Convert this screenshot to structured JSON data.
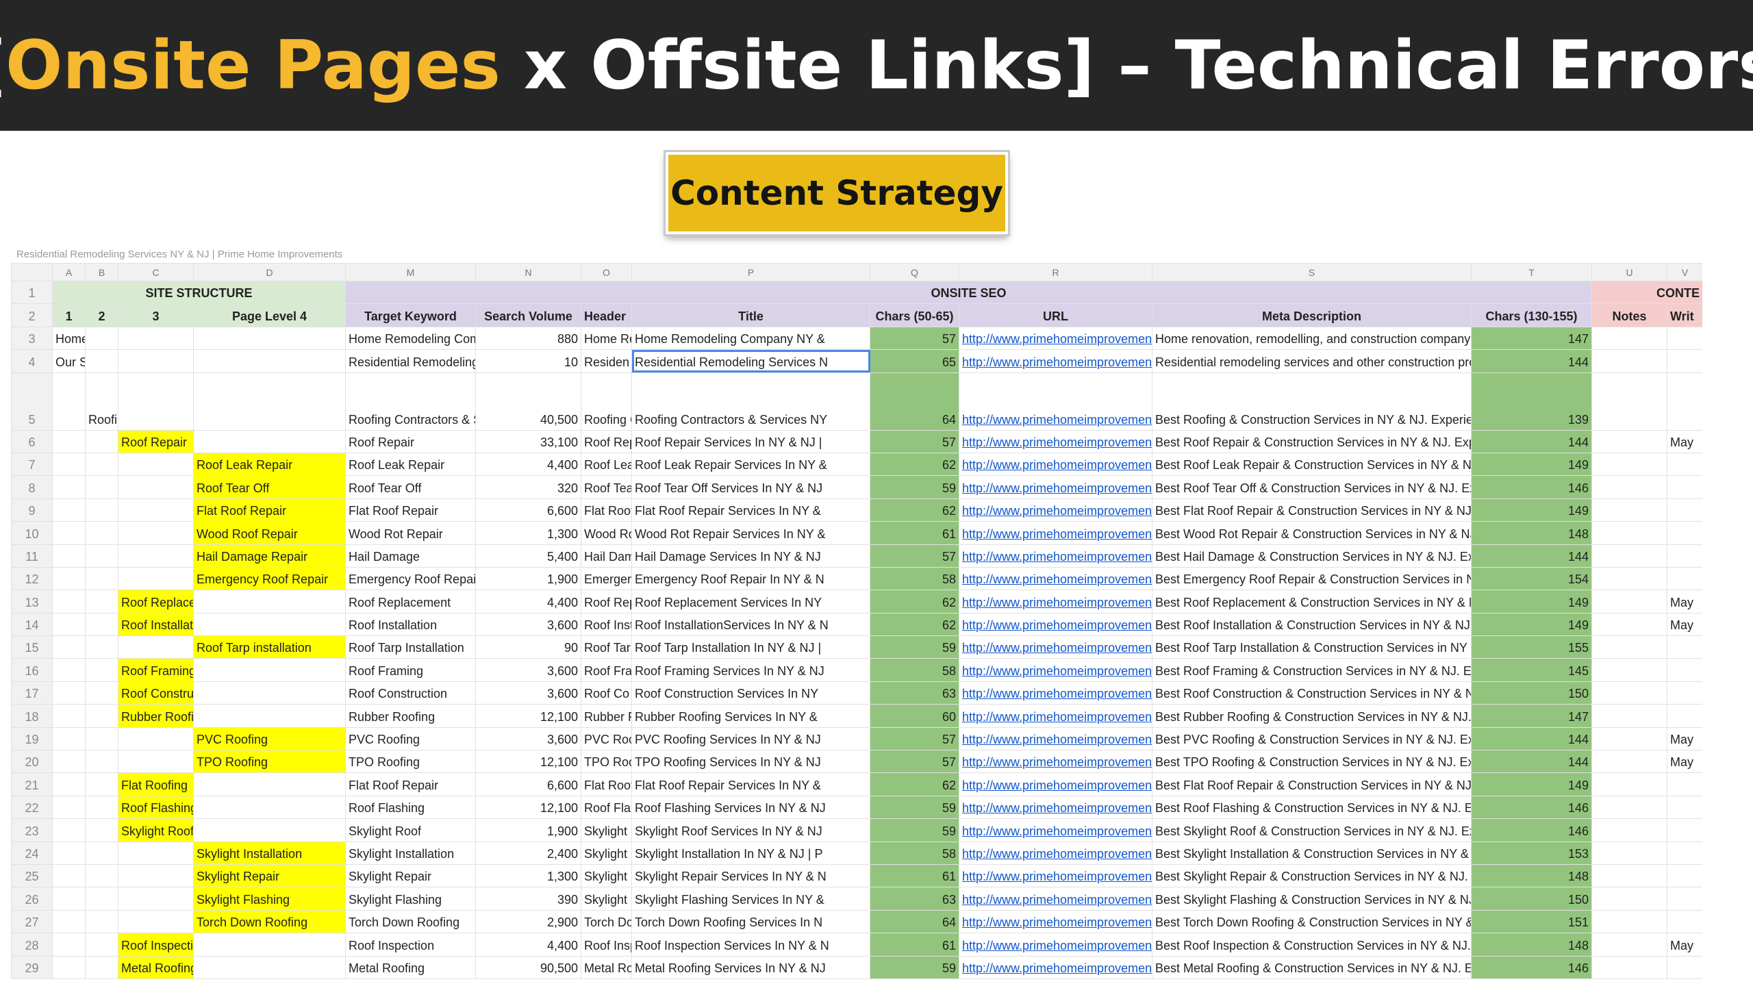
{
  "banner": {
    "bracket_open": "[",
    "onsite": "Onsite Pages",
    "rest": " x Offsite Links] – Technical Errors"
  },
  "button": {
    "label": "Content Strategy"
  },
  "formula_bar": {
    "text": "Residential Remodeling Services NY & NJ | Prime Home Improvements"
  },
  "columns": [
    "A",
    "B",
    "C",
    "D",
    "M",
    "N",
    "O",
    "P",
    "Q",
    "R",
    "S",
    "T",
    "U",
    "V"
  ],
  "sections": {
    "site_structure": "SITE STRUCTURE",
    "onsite_seo": "ONSITE SEO",
    "content": "CONTE"
  },
  "headers": {
    "l1": "1",
    "l2": "2",
    "l3": "3",
    "l4": "Page Level 4",
    "target_keyword": "Target Keyword",
    "search_volume": "Search Volume",
    "header": "Header",
    "title": "Title",
    "chars_title": "Chars (50-65)",
    "url": "URL",
    "meta_description": "Meta Description",
    "chars_meta": "Chars (130-155)",
    "notes": "Notes",
    "writer": "Writ"
  },
  "url_text": "http://www.primehomeimprovement",
  "rows": [
    {
      "n": "3",
      "a": "Home",
      "b": "",
      "c": "",
      "d": "",
      "kw": "Home Remodeling Com",
      "sv": "880",
      "hd": "Home Re",
      "title": "Home Remodeling Company NY &",
      "tc": "57",
      "meta": "Home renovation, remodelling, and construction company s",
      "mc": "147",
      "notes": "",
      "wr": ""
    },
    {
      "n": "4",
      "a": "Our Services",
      "b": "",
      "c": "",
      "d": "",
      "kw": "Residential Remodeling",
      "sv": "10",
      "hd": "Residen",
      "title": "Residential Remodeling Services N",
      "tc": "65",
      "meta": "Residential remodeling services and other construction proj",
      "mc": "144",
      "notes": "",
      "wr": ""
    },
    {
      "n": "5",
      "a": "",
      "b": "Roofing",
      "c": "",
      "d": "",
      "kw": "Roofing Contractors & S",
      "sv": "40,500",
      "hd": "Roofing C",
      "title": "Roofing Contractors & Services NY",
      "tc": "64",
      "meta": "Best Roofing & Construction Services in NY & NJ. Experien",
      "mc": "139",
      "notes": "",
      "wr": ""
    },
    {
      "n": "6",
      "a": "",
      "b": "",
      "c": "Roof Repair",
      "d": "",
      "kw": "Roof Repair",
      "sv": "33,100",
      "hd": "Roof Rep",
      "title": "Roof Repair Services In NY & NJ |",
      "tc": "57",
      "meta": "Best Roof Repair  & Construction Services in NY & NJ. Exp",
      "mc": "144",
      "notes": "",
      "wr": "May"
    },
    {
      "n": "7",
      "a": "",
      "b": "",
      "c": "",
      "d": "Roof Leak Repair",
      "kw": "Roof Leak Repair",
      "sv": "4,400",
      "hd": "Roof Lea",
      "title": "Roof Leak Repair Services In NY &",
      "tc": "62",
      "meta": "Best Roof Leak Repair  & Construction Services in NY & NJ",
      "mc": "149",
      "notes": "",
      "wr": ""
    },
    {
      "n": "8",
      "a": "",
      "b": "",
      "c": "",
      "d": "Roof Tear Off",
      "kw": "Roof Tear Off",
      "sv": "320",
      "hd": "Roof Tea",
      "title": "Roof Tear Off Services In NY & NJ",
      "tc": "59",
      "meta": "Best Roof Tear Off  & Construction Services in NY & NJ. Ex",
      "mc": "146",
      "notes": "",
      "wr": ""
    },
    {
      "n": "9",
      "a": "",
      "b": "",
      "c": "",
      "d": "Flat Roof Repair",
      "kw": "Flat Roof Repair",
      "sv": "6,600",
      "hd": "Flat Roof",
      "title": "Flat Roof Repair Services In NY &",
      "tc": "62",
      "meta": "Best Flat Roof Repair  & Construction Services in NY & NJ.",
      "mc": "149",
      "notes": "",
      "wr": ""
    },
    {
      "n": "10",
      "a": "",
      "b": "",
      "c": "",
      "d": "Wood Roof Repair",
      "kw": "Wood Rot Repair",
      "sv": "1,300",
      "hd": "Wood Ro",
      "title": "Wood Rot Repair Services In NY &",
      "tc": "61",
      "meta": "Best Wood Rot Repair  & Construction Services in NY & NJ",
      "mc": "148",
      "notes": "",
      "wr": ""
    },
    {
      "n": "11",
      "a": "",
      "b": "",
      "c": "",
      "d": "Hail Damage Repair",
      "kw": "Hail Damage",
      "sv": "5,400",
      "hd": "Hail Dam",
      "title": "Hail Damage Services In NY & NJ",
      "tc": "57",
      "meta": "Best Hail Damage  & Construction Services in NY & NJ. Exp",
      "mc": "144",
      "notes": "",
      "wr": ""
    },
    {
      "n": "12",
      "a": "",
      "b": "",
      "c": "",
      "d": "Emergency Roof Repair",
      "kw": "Emergency Roof Repair",
      "sv": "1,900",
      "hd": "Emergen",
      "title": "Emergency Roof Repair In NY & N",
      "tc": "58",
      "meta": "Best Emergency Roof Repair  & Construction Services in N",
      "mc": "154",
      "notes": "",
      "wr": ""
    },
    {
      "n": "13",
      "a": "",
      "b": "",
      "c": "Roof Replacement",
      "d": "",
      "kw": "Roof Replacement",
      "sv": "4,400",
      "hd": "Roof Rep",
      "title": "Roof Replacement Services In NY",
      "tc": "62",
      "meta": "Best Roof Replacement  & Construction Services in NY & N",
      "mc": "149",
      "notes": "",
      "wr": "May"
    },
    {
      "n": "14",
      "a": "",
      "b": "",
      "c": "Roof Installation",
      "d": "",
      "kw": "Roof Installation",
      "sv": "3,600",
      "hd": "Roof Inst",
      "title": "Roof InstallationServices In NY & N",
      "tc": "62",
      "meta": "Best Roof Installation & Construction Services in NY & NJ. E",
      "mc": "149",
      "notes": "",
      "wr": "May"
    },
    {
      "n": "15",
      "a": "",
      "b": "",
      "c": "",
      "d": "Roof Tarp installation",
      "kw": "Roof Tarp Installation",
      "sv": "90",
      "hd": "Roof Tar",
      "title": "Roof Tarp Installation In NY & NJ |",
      "tc": "59",
      "meta": "Best Roof Tarp Installation  & Construction Services in NY &",
      "mc": "155",
      "notes": "",
      "wr": ""
    },
    {
      "n": "16",
      "a": "",
      "b": "",
      "c": "Roof Framing",
      "d": "",
      "kw": "Roof Framing",
      "sv": "3,600",
      "hd": "Roof Fra",
      "title": "Roof Framing Services In NY & NJ",
      "tc": "58",
      "meta": "Best Roof Framing  & Construction Services in NY & NJ. Ex",
      "mc": "145",
      "notes": "",
      "wr": ""
    },
    {
      "n": "17",
      "a": "",
      "b": "",
      "c": "Roof Construction",
      "d": "",
      "kw": "Roof Construction",
      "sv": "3,600",
      "hd": "Roof Co",
      "title": "Roof Construction Services In NY",
      "tc": "63",
      "meta": "Best Roof Construction  & Construction Services in NY & NJ",
      "mc": "150",
      "notes": "",
      "wr": ""
    },
    {
      "n": "18",
      "a": "",
      "b": "",
      "c": "Rubber Roofing",
      "d": "",
      "kw": "Rubber Roofing",
      "sv": "12,100",
      "hd": "Rubber R",
      "title": "Rubber Roofing Services In NY &",
      "tc": "60",
      "meta": "Best Rubber Roofing  & Construction Services in NY & NJ. I",
      "mc": "147",
      "notes": "",
      "wr": ""
    },
    {
      "n": "19",
      "a": "",
      "b": "",
      "c": "",
      "d": "PVC Roofing",
      "kw": "PVC Roofing",
      "sv": "3,600",
      "hd": "PVC Roo",
      "title": "PVC Roofing Services In NY & NJ",
      "tc": "57",
      "meta": "Best PVC Roofing  & Construction Services in NY & NJ. Exp",
      "mc": "144",
      "notes": "",
      "wr": "May"
    },
    {
      "n": "20",
      "a": "",
      "b": "",
      "c": "",
      "d": "TPO Roofing",
      "kw": "TPO Roofing",
      "sv": "12,100",
      "hd": "TPO Roo",
      "title": "TPO Roofing Services In NY & NJ",
      "tc": "57",
      "meta": "Best TPO Roofing  & Construction Services in NY & NJ. Exp",
      "mc": "144",
      "notes": "",
      "wr": "May"
    },
    {
      "n": "21",
      "a": "",
      "b": "",
      "c": "Flat Roofing",
      "d": "",
      "kw": "Flat Roof Repair",
      "sv": "6,600",
      "hd": "Flat Roof",
      "title": "Flat Roof Repair Services In NY &",
      "tc": "62",
      "meta": "Best Flat Roof Repair  & Construction Services in NY & NJ.",
      "mc": "149",
      "notes": "",
      "wr": ""
    },
    {
      "n": "22",
      "a": "",
      "b": "",
      "c": "Roof Flashing",
      "d": "",
      "kw": "Roof Flashing",
      "sv": "12,100",
      "hd": "Roof Fla",
      "title": "Roof Flashing Services In NY & NJ",
      "tc": "59",
      "meta": "Best Roof Flashing  & Construction Services in NY & NJ. Ex",
      "mc": "146",
      "notes": "",
      "wr": ""
    },
    {
      "n": "23",
      "a": "",
      "b": "",
      "c": "Skylight Roofing",
      "d": "",
      "kw": "Skylight Roof",
      "sv": "1,900",
      "hd": "Skylight R",
      "title": "Skylight Roof Services In NY & NJ",
      "tc": "59",
      "meta": "Best Skylight Roof  & Construction Services in NY & NJ. Ex",
      "mc": "146",
      "notes": "",
      "wr": ""
    },
    {
      "n": "24",
      "a": "",
      "b": "",
      "c": "",
      "d": "Skylight Installation",
      "kw": "Skylight Installation",
      "sv": "2,400",
      "hd": "Skylight I",
      "title": "Skylight Installation In NY & NJ | P",
      "tc": "58",
      "meta": "Best Skylight Installation & Construction Services in NY & N",
      "mc": "153",
      "notes": "",
      "wr": ""
    },
    {
      "n": "25",
      "a": "",
      "b": "",
      "c": "",
      "d": "Skylight Repair",
      "kw": "Skylight Repair",
      "sv": "1,300",
      "hd": "Skylight R",
      "title": "Skylight Repair Services In NY & N",
      "tc": "61",
      "meta": "Best Skylight Repair  & Construction Services in NY & NJ. E",
      "mc": "148",
      "notes": "",
      "wr": ""
    },
    {
      "n": "26",
      "a": "",
      "b": "",
      "c": "",
      "d": "Skylight Flashing",
      "kw": "Skylight Flashing",
      "sv": "390",
      "hd": "Skylight F",
      "title": "Skylight Flashing Services In NY &",
      "tc": "63",
      "meta": "Best Skylight Flashing  & Construction Services in NY & NJ",
      "mc": "150",
      "notes": "",
      "wr": ""
    },
    {
      "n": "27",
      "a": "",
      "b": "",
      "c": "",
      "d": "Torch Down Roofing",
      "kw": "Torch Down Roofing",
      "sv": "2,900",
      "hd": "Torch Do",
      "title": "Torch Down Roofing Services In N",
      "tc": "64",
      "meta": "Best Torch Down Roofing  & Construction Services in NY &",
      "mc": "151",
      "notes": "",
      "wr": ""
    },
    {
      "n": "28",
      "a": "",
      "b": "",
      "c": "Roof Inspection",
      "d": "",
      "kw": "Roof Inspection",
      "sv": "4,400",
      "hd": "Roof Insp",
      "title": "Roof Inspection Services In NY & N",
      "tc": "61",
      "meta": "Best Roof Inspection  & Construction Services in NY & NJ. I",
      "mc": "148",
      "notes": "",
      "wr": "May"
    },
    {
      "n": "29",
      "a": "",
      "b": "",
      "c": "Metal Roofing",
      "d": "",
      "kw": "Metal Roofing",
      "sv": "90,500",
      "hd": "Metal Ro",
      "title": "Metal Roofing Services In NY & NJ",
      "tc": "59",
      "meta": "Best Metal Roofing  & Construction Services in NY & NJ. Ex",
      "mc": "146",
      "notes": "",
      "wr": ""
    }
  ]
}
